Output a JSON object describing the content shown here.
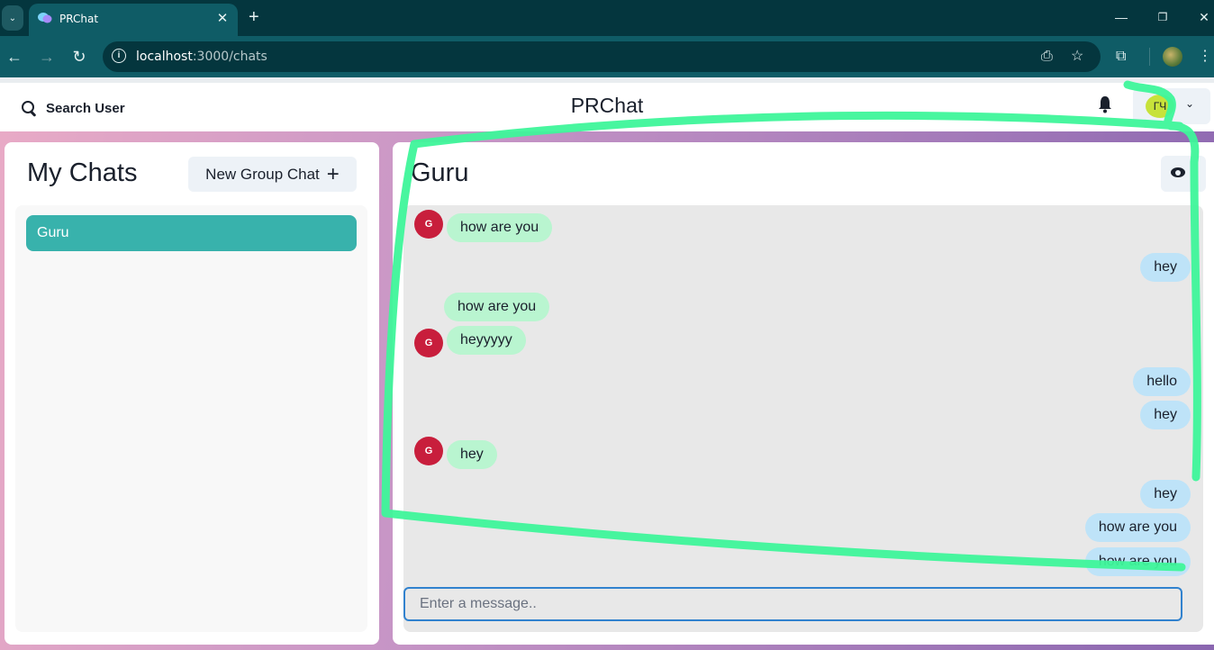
{
  "browser": {
    "tab_title": "PRChat",
    "url_host": "localhost",
    "url_path": ":3000/chats",
    "accent": "#0f5c66"
  },
  "app": {
    "search_label": "Search User",
    "title": "PRChat",
    "profile_initials": "ГЧ"
  },
  "my_chats": {
    "heading": "My Chats",
    "new_group_label": "New Group Chat",
    "chats": [
      {
        "name": "Guru",
        "selected": true,
        "color": "#38b2ac"
      }
    ]
  },
  "chatbox": {
    "name": "Guru",
    "input_placeholder": "Enter a message..",
    "messages": [
      {
        "text": "how are you",
        "direction": "in",
        "avatar": "G"
      },
      {
        "text": "hey",
        "direction": "out"
      },
      {
        "text": "how are you",
        "direction": "in"
      },
      {
        "text": "heyyyyy",
        "direction": "in",
        "avatar": "G"
      },
      {
        "text": "hello",
        "direction": "out"
      },
      {
        "text": "hey",
        "direction": "out"
      },
      {
        "text": "hey",
        "direction": "in",
        "avatar": "G"
      },
      {
        "text": "hey",
        "direction": "out"
      },
      {
        "text": "how are you",
        "direction": "out"
      },
      {
        "text": "how are you",
        "direction": "out"
      }
    ],
    "colors": {
      "incoming": "#b9f5d0",
      "outgoing": "#bee3f8",
      "avatar": "#c81e3c"
    }
  }
}
